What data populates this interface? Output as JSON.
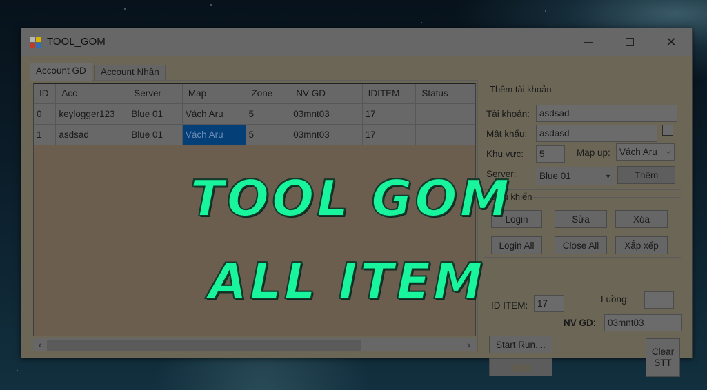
{
  "window": {
    "title": "TOOL_GOM",
    "controls": {
      "minimize": "minimize",
      "maximize": "maximize",
      "close": "close"
    }
  },
  "tabs": [
    {
      "label": "Account GD",
      "active": true
    },
    {
      "label": "Account Nhận",
      "active": false
    }
  ],
  "grid": {
    "columns": [
      "ID",
      "Acc",
      "Server",
      "Map",
      "Zone",
      "NV GD",
      "IDITEM",
      "Status"
    ],
    "rows": [
      [
        "0",
        "keylogger123",
        "Blue 01",
        "Vách Aru",
        "5",
        "03mnt03",
        "17",
        ""
      ],
      [
        "1",
        "asdsad",
        "Blue 01",
        "Vách Aru",
        "5",
        "03mnt03",
        "17",
        ""
      ]
    ],
    "selected_cell": {
      "row": 1,
      "column": "Map"
    }
  },
  "overlay": {
    "line1": "TOOL GOM",
    "line2": "ALL ITEM",
    "color": "#19f59c"
  },
  "add_account": {
    "title": "Thêm tài khoản",
    "account_label": "Tài khoản:",
    "account_value": "asdsad",
    "password_label": "Mật khẩu:",
    "password_value": "asdasd",
    "show_password_checked": false,
    "zone_label": "Khu vực:",
    "zone_value": "5",
    "map_label": "Map up:",
    "map_value": "Vách Aru",
    "server_label": "Server:",
    "server_value": "Blue 01",
    "add_button": "Thêm"
  },
  "controls": {
    "title": "Điều khiển",
    "login": "Login",
    "edit": "Sửa",
    "delete": "Xóa",
    "login_all": "Login All",
    "close_all": "Close All",
    "arrange": "Xắp xếp"
  },
  "run": {
    "id_item_label": "ID ITEM:",
    "id_item_value": "17",
    "threads_label": "Luồng:",
    "threads_value": "",
    "nv_gd_label": "NV GD",
    "nv_gd_colon": ":",
    "nv_gd_value": "03mnt03",
    "start_button": "Start Run....",
    "stop_button": "Stop",
    "clear_button_line1": "Clear",
    "clear_button_line2": "STT"
  },
  "colors": {
    "selection": "#043f78",
    "overlay_text": "#19f59c"
  }
}
